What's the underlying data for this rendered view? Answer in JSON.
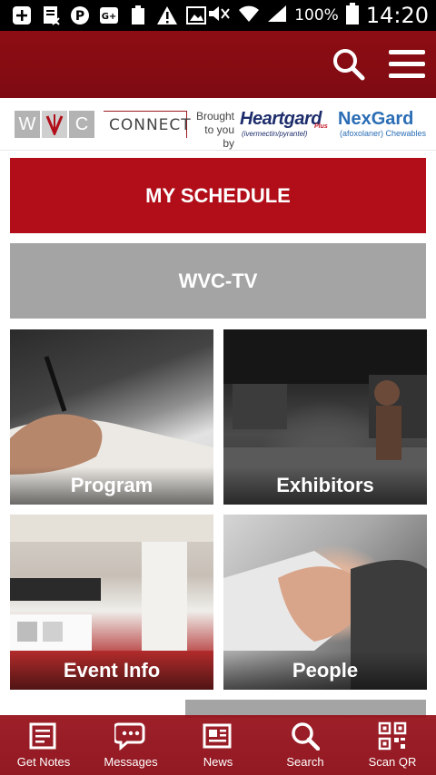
{
  "status_bar": {
    "battery_text": "100%",
    "time": "14:20"
  },
  "banner": {
    "wvc_letters": [
      "W",
      "V",
      "C"
    ],
    "connect": "CONNECT",
    "brought_line1": "Brought",
    "brought_line2": "to you by",
    "heartgard": "Heartgard",
    "heartgard_plus": "Plus",
    "heartgard_sub": "(ivermectin/pyrantel)",
    "nexgard": "NexGard",
    "nexgard_sub": "(afoxolaner) Chewables"
  },
  "main": {
    "schedule_label": "MY SCHEDULE",
    "tv_label": "WVC-TV",
    "tiles": [
      {
        "label": "Program"
      },
      {
        "label": "Exhibitors"
      },
      {
        "label": "Event Info"
      },
      {
        "label": "People"
      }
    ]
  },
  "bottom_nav": {
    "items": [
      {
        "label": "Get Notes",
        "icon": "notes-icon"
      },
      {
        "label": "Messages",
        "icon": "messages-icon"
      },
      {
        "label": "News",
        "icon": "news-icon"
      },
      {
        "label": "Search",
        "icon": "search-icon"
      },
      {
        "label": "Scan QR",
        "icon": "qr-icon"
      }
    ]
  },
  "colors": {
    "brand_red": "#b10e19",
    "header_red": "#8e0d14",
    "tv_gray": "#a4a4a4"
  }
}
